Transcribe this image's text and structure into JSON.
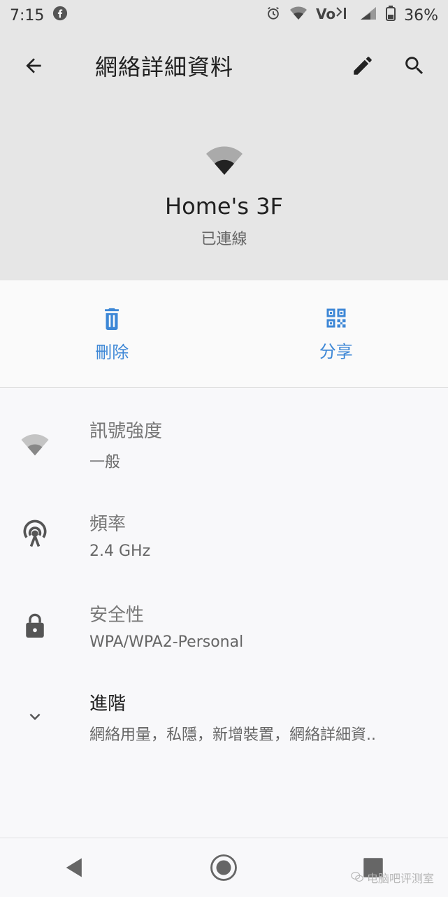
{
  "status_bar": {
    "time": "7:15",
    "battery": "36%",
    "icons": [
      "facebook-icon",
      "alarm-icon",
      "wifi-status-icon",
      "volte-icon",
      "cell-signal-icon",
      "battery-icon"
    ]
  },
  "app_bar": {
    "title": "網絡詳細資料",
    "icons": [
      "back-arrow-icon",
      "edit-pencil-icon",
      "search-icon"
    ]
  },
  "hero": {
    "network_name": "Home's 3F",
    "status": "已連線"
  },
  "actions": {
    "delete_label": "刪除",
    "share_label": "分享"
  },
  "details": {
    "signal": {
      "title": "訊號強度",
      "value": "一般"
    },
    "frequency": {
      "title": "頻率",
      "value": "2.4 GHz"
    },
    "security": {
      "title": "安全性",
      "value": "WPA/WPA2-Personal"
    },
    "advanced": {
      "title": "進階",
      "value": "網絡用量，私隱，新增裝置，網絡詳細資.."
    }
  },
  "watermark": {
    "text": "电脑吧评测室"
  }
}
